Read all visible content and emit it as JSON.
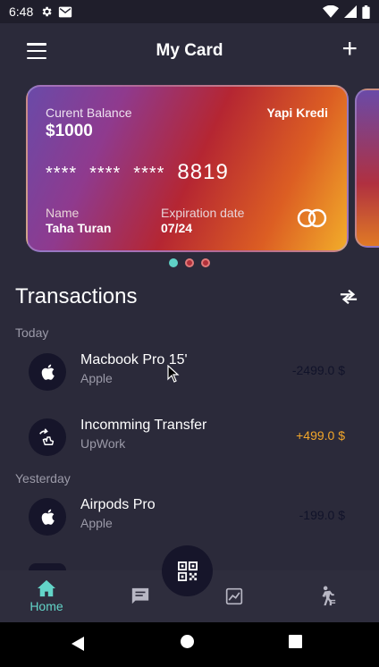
{
  "status_bar": {
    "time": "6:48"
  },
  "header": {
    "title": "My Card",
    "add_label": "+"
  },
  "card": {
    "balance_label": "Curent Balance",
    "balance_value": "$1000",
    "bank": "Yapi Kredi",
    "masked_groups": [
      "****",
      "****",
      "****"
    ],
    "last_digits": "8819",
    "name_label": "Name",
    "name_value": "Taha Turan",
    "expiration_label": "Expiration date",
    "expiration_value": "07/24"
  },
  "carousel": {
    "count": 3,
    "active_index": 0
  },
  "transactions": {
    "title": "Transactions",
    "sections": [
      {
        "label": "Today"
      },
      {
        "label": "Yesterday"
      }
    ],
    "items": [
      {
        "name": "Macbook Pro 15'",
        "sub": "Apple",
        "amount": "-2499.0 $",
        "icon": "apple-icon"
      },
      {
        "name": "Incomming Transfer",
        "sub": "UpWork",
        "amount": "+499.0 $",
        "icon": "transfer-icon"
      },
      {
        "name": "Airpods Pro",
        "sub": "Apple",
        "amount": "-199.0 $",
        "icon": "apple-icon"
      }
    ]
  },
  "bottom_nav": {
    "home_label": "Home",
    "active_color": "#63d4c8"
  },
  "colors": {
    "background": "#2b2a3a",
    "accent": "#5fd1c6",
    "positive": "#f2a62a"
  }
}
